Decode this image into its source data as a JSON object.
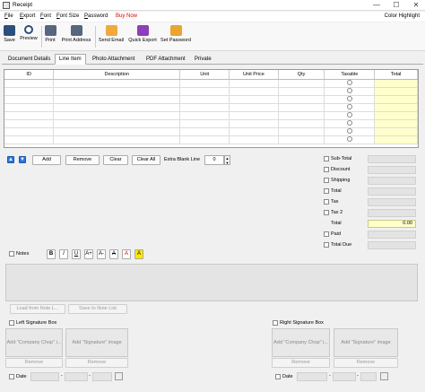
{
  "window": {
    "title": "Receipt",
    "min": "—",
    "max": "☐",
    "close": "✕"
  },
  "menu": {
    "items": [
      {
        "label": "File",
        "u": "F",
        "rest": "ile"
      },
      {
        "label": "Export",
        "u": "E",
        "rest": "xport"
      },
      {
        "label": "Font",
        "u": "F",
        "rest": "ont"
      },
      {
        "label": "Font Size",
        "u": "F",
        "rest": "ont Size"
      },
      {
        "label": "Password",
        "u": "P",
        "rest": "assword"
      }
    ],
    "buy_now": "Buy Now",
    "color_highlight": "Color Highlight"
  },
  "toolbar": {
    "save": "Save",
    "preview": "Preview",
    "print": "Print",
    "print_address": "Print Address",
    "send_email": "Send Email",
    "quick_export": "Quick Export",
    "set_password": "Set Password"
  },
  "tabs": [
    "Document Details",
    "Line Item",
    "Photo Attachment",
    "PDF Attachment",
    "Private"
  ],
  "grid": {
    "headers": [
      "ID",
      "Description",
      "Unit",
      "Unit Price",
      "Qty",
      "Taxable",
      "Total"
    ],
    "row_count": 8
  },
  "line_controls": {
    "up": "▲",
    "down": "▼",
    "add": "Add",
    "remove": "Remove",
    "clear": "Clear",
    "clear_all": "Clear All",
    "extra_blank_line_label": "Extra Blank Line",
    "extra_blank_line_value": "0",
    "spin_up": "▲",
    "spin_down": "▼"
  },
  "totals": {
    "subtotal": "Sub-Total",
    "discount": "Discount",
    "shipping": "Shipping",
    "total1": "Total",
    "tax": "Tax",
    "tax2": "Tax 2",
    "total": "Total",
    "total_value": "0.00",
    "paid": "Paid",
    "total_due": "Total Due"
  },
  "notes": {
    "label": "Notes",
    "bold": "B",
    "italic": "I",
    "underline": "U",
    "grow": "A+",
    "shrink": "A-",
    "strike": "A",
    "color": "A",
    "highlight": "A",
    "load": "Load from Note L...",
    "save": "Save to Note List"
  },
  "signature": {
    "left_label": "Left Signature Box",
    "right_label": "Right Signature Box",
    "add_chop": "Add \"Company Chop\" i...",
    "add_signature": "Add \"Signature\" image",
    "remove": "Remove",
    "date": "Date",
    "dash": "-"
  }
}
